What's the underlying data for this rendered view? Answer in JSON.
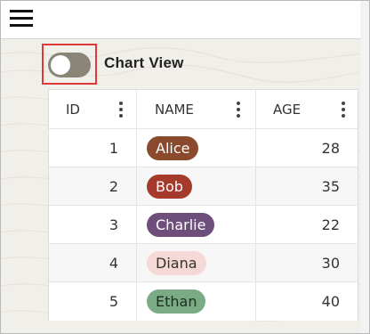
{
  "toolbar": {
    "menu_icon": "hamburger-menu-icon"
  },
  "view_toggle": {
    "label": "Chart View",
    "checked": false,
    "highlighted": true,
    "highlight_color": "#e0393a"
  },
  "grid": {
    "columns": [
      {
        "key": "id",
        "label": "ID"
      },
      {
        "key": "name",
        "label": "NAME"
      },
      {
        "key": "age",
        "label": "AGE"
      }
    ],
    "rows": [
      {
        "id": "1",
        "name": "Alice",
        "age": "28",
        "pill_bg": "#8b4a2e",
        "pill_fg": "#ffffff"
      },
      {
        "id": "2",
        "name": "Bob",
        "age": "35",
        "pill_bg": "#a53a2c",
        "pill_fg": "#ffffff"
      },
      {
        "id": "3",
        "name": "Charlie",
        "age": "22",
        "pill_bg": "#6e4e7b",
        "pill_fg": "#ffffff"
      },
      {
        "id": "4",
        "name": "Diana",
        "age": "30",
        "pill_bg": "#f5d9d6",
        "pill_fg": "#333333"
      },
      {
        "id": "5",
        "name": "Ethan",
        "age": "40",
        "pill_bg": "#7aab85",
        "pill_fg": "#1e2e22"
      }
    ]
  }
}
